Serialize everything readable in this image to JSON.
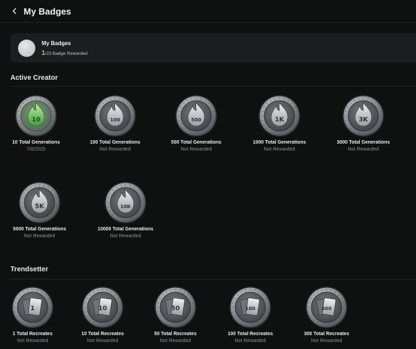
{
  "header": {
    "title": "My Badges"
  },
  "summary": {
    "title": "My Badges",
    "earned": "1",
    "total_text": "/23 Badge Rewarded"
  },
  "sections": [
    {
      "title": "Active Creator",
      "badges": [
        {
          "name": "10 Total Generations",
          "status": "7/8/2025",
          "icon": "flame-10-icon",
          "earned": true,
          "glyph": "10"
        },
        {
          "name": "100 Total Generations",
          "status": "Not Rewarded",
          "icon": "flame-100-icon",
          "earned": false,
          "glyph": "100"
        },
        {
          "name": "500 Total Generations",
          "status": "Not Rewarded",
          "icon": "flame-500-icon",
          "earned": false,
          "glyph": "500"
        },
        {
          "name": "1000 Total Generations",
          "status": "Not Rewarded",
          "icon": "flame-1000-icon",
          "earned": false,
          "glyph": "1K"
        },
        {
          "name": "3000 Total Generations",
          "status": "Not Rewarded",
          "icon": "flame-3000-icon",
          "earned": false,
          "glyph": "3K"
        },
        {
          "name": "5000 Total Generations",
          "status": "Not Rewarded",
          "icon": "flame-5000-icon",
          "earned": false,
          "glyph": "5K"
        },
        {
          "name": "10000 Total Generations",
          "status": "Not Rewarded",
          "icon": "flame-10000-icon",
          "earned": false,
          "glyph": "10K"
        }
      ]
    },
    {
      "title": "Trendsetter",
      "badges": [
        {
          "name": "1 Total Recreates",
          "status": "Not Rewarded",
          "icon": "cards-1-icon",
          "earned": false,
          "glyph": "1"
        },
        {
          "name": "10 Total Recreates",
          "status": "Not Rewarded",
          "icon": "cards-10-icon",
          "earned": false,
          "glyph": "10"
        },
        {
          "name": "50 Total Recreates",
          "status": "Not Rewarded",
          "icon": "cards-50-icon",
          "earned": false,
          "glyph": "50"
        },
        {
          "name": "100 Total Recreates",
          "status": "Not Rewarded",
          "icon": "cards-100-icon",
          "earned": false,
          "glyph": "100"
        },
        {
          "name": "300 Total Recreates",
          "status": "Not Rewarded",
          "icon": "cards-300-icon",
          "earned": false,
          "glyph": "300"
        }
      ]
    }
  ],
  "colors": {
    "background": "#0f1110",
    "card": "#1b1e21",
    "earned_accent": "#8ee07a",
    "muted_text": "#8d9195"
  }
}
